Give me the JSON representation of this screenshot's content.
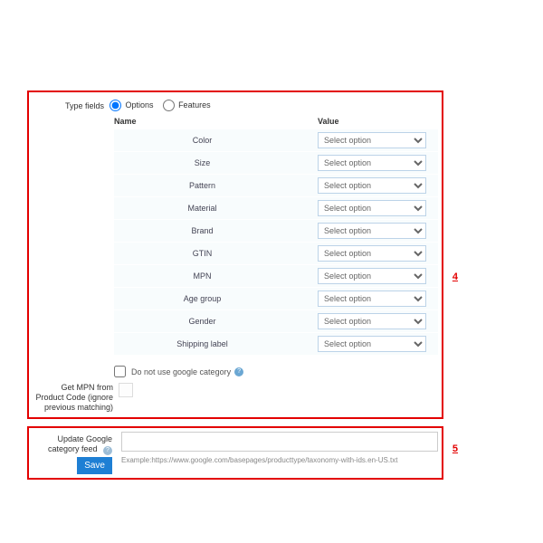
{
  "typeFields": {
    "label": "Type fields",
    "options": [
      {
        "label": "Options",
        "checked": true
      },
      {
        "label": "Features",
        "checked": false
      }
    ]
  },
  "columns": {
    "name": "Name",
    "value": "Value"
  },
  "selectPlaceholder": "Select option",
  "rows": [
    {
      "name": "Color"
    },
    {
      "name": "Size"
    },
    {
      "name": "Pattern"
    },
    {
      "name": "Material"
    },
    {
      "name": "Brand"
    },
    {
      "name": "GTIN"
    },
    {
      "name": "MPN"
    },
    {
      "name": "Age group"
    },
    {
      "name": "Gender"
    },
    {
      "name": "Shipping label"
    }
  ],
  "doNotUseGoogle": "Do not use google category",
  "getMpnLabel": "Get MPN from Product Code (ignore previous matching)",
  "updateCategory": {
    "label": "Update Google category feed",
    "save": "Save",
    "example": "Example:https://www.google.com/basepages/producttype/taxonomy-with-ids.en-US.txt"
  },
  "annotations": {
    "a4": "4",
    "a5": "5"
  }
}
